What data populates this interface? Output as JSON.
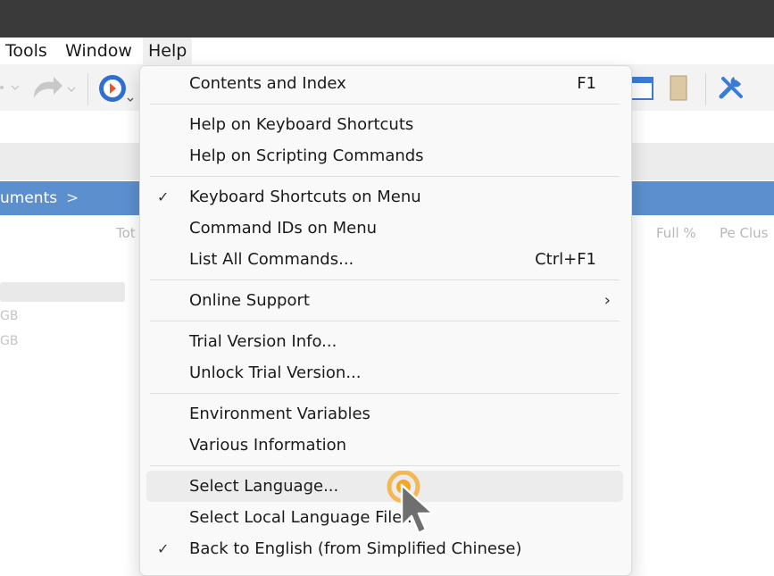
{
  "menubar": {
    "items": [
      "Tools",
      "Window",
      "Help"
    ]
  },
  "breadcrumb": {
    "text": "uments",
    "chevron": ">"
  },
  "columns": {
    "col1": "Tot",
    "col2": "Full %",
    "col3": "Pe Clus"
  },
  "ghost": {
    "line1": "GB",
    "line2": "GB"
  },
  "help_menu": {
    "contents": {
      "label": "Contents and Index",
      "shortcut": "F1"
    },
    "kb_help": {
      "label": "Help on Keyboard Shortcuts"
    },
    "script_help": {
      "label": "Help on Scripting Commands"
    },
    "kb_on_menu": {
      "label": "Keyboard Shortcuts on Menu",
      "check": "✓"
    },
    "cmd_ids": {
      "label": "Command IDs on Menu"
    },
    "list_all": {
      "label": "List All Commands...",
      "shortcut": "Ctrl+F1"
    },
    "online": {
      "label": "Online Support",
      "arrow": "›"
    },
    "trial_info": {
      "label": "Trial Version Info..."
    },
    "unlock_trial": {
      "label": "Unlock Trial Version..."
    },
    "env_vars": {
      "label": "Environment Variables"
    },
    "various": {
      "label": "Various Information"
    },
    "select_lang": {
      "label": "Select Language..."
    },
    "select_local_lang": {
      "label": "Select Local Language File..."
    },
    "back_english": {
      "label": "Back to English (from Simplified Chinese)",
      "check": "✓"
    }
  },
  "colors": {
    "titlebar": "#3a3a3a",
    "breadcrumb_bar": "#5b8fcd",
    "click_ring": "#f5a623",
    "tools_icon": "#3b7bd4"
  }
}
